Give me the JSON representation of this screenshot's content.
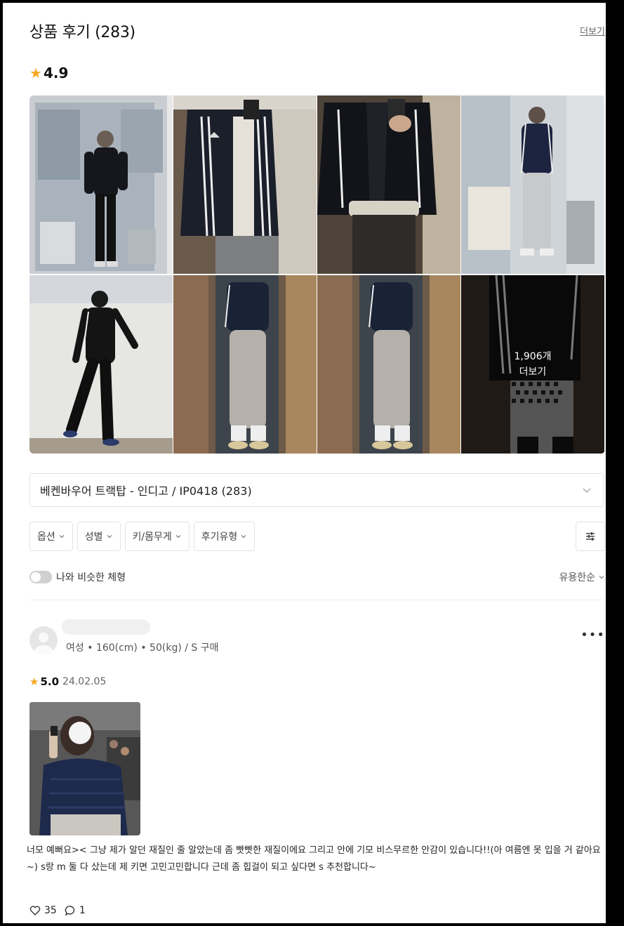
{
  "header": {
    "title": "상품 후기 (283)",
    "more_label": "더보기"
  },
  "rating": {
    "value": "4.9"
  },
  "gallery": {
    "more_count": "1,906개",
    "more_label": "더보기"
  },
  "variant_select": {
    "selected": "베켄바우어 트랙탑 - 인디고 / IP0418 (283)"
  },
  "filters": [
    {
      "label": "옵션"
    },
    {
      "label": "성별"
    },
    {
      "label": "키/몸무게"
    },
    {
      "label": "후기유형"
    }
  ],
  "similar_body": {
    "label": "나와 비슷한 체형"
  },
  "sort": {
    "label": "유용한순"
  },
  "review": {
    "body_info": "여성 • 160(cm) • 50(kg)  /  S 구매",
    "score": "5.0",
    "date": "24.02.05",
    "text": "너모 예뻐요>< 그냥 제가 알던 재질인 줄 알았는데 좀 빳빳한 재질이에요 그리고 안에 기모 비스무르한 안감이 있습니다!!(아 여름엔 못 입을 거 같아요~) s랑 m 둘 다 샀는데 제 키면 고민고민합니다 근데 좀 힙걸이 되고 싶다면 s 추천합니다~",
    "likes": "35",
    "comments": "1"
  },
  "colors": {
    "accent_star": "#f5a623",
    "border": "#e3e3e3"
  },
  "icons": [
    "star-icon",
    "chevron-down-icon",
    "filter-settings-icon",
    "toggle-switch",
    "more-options-icon",
    "heart-icon",
    "comment-icon"
  ]
}
